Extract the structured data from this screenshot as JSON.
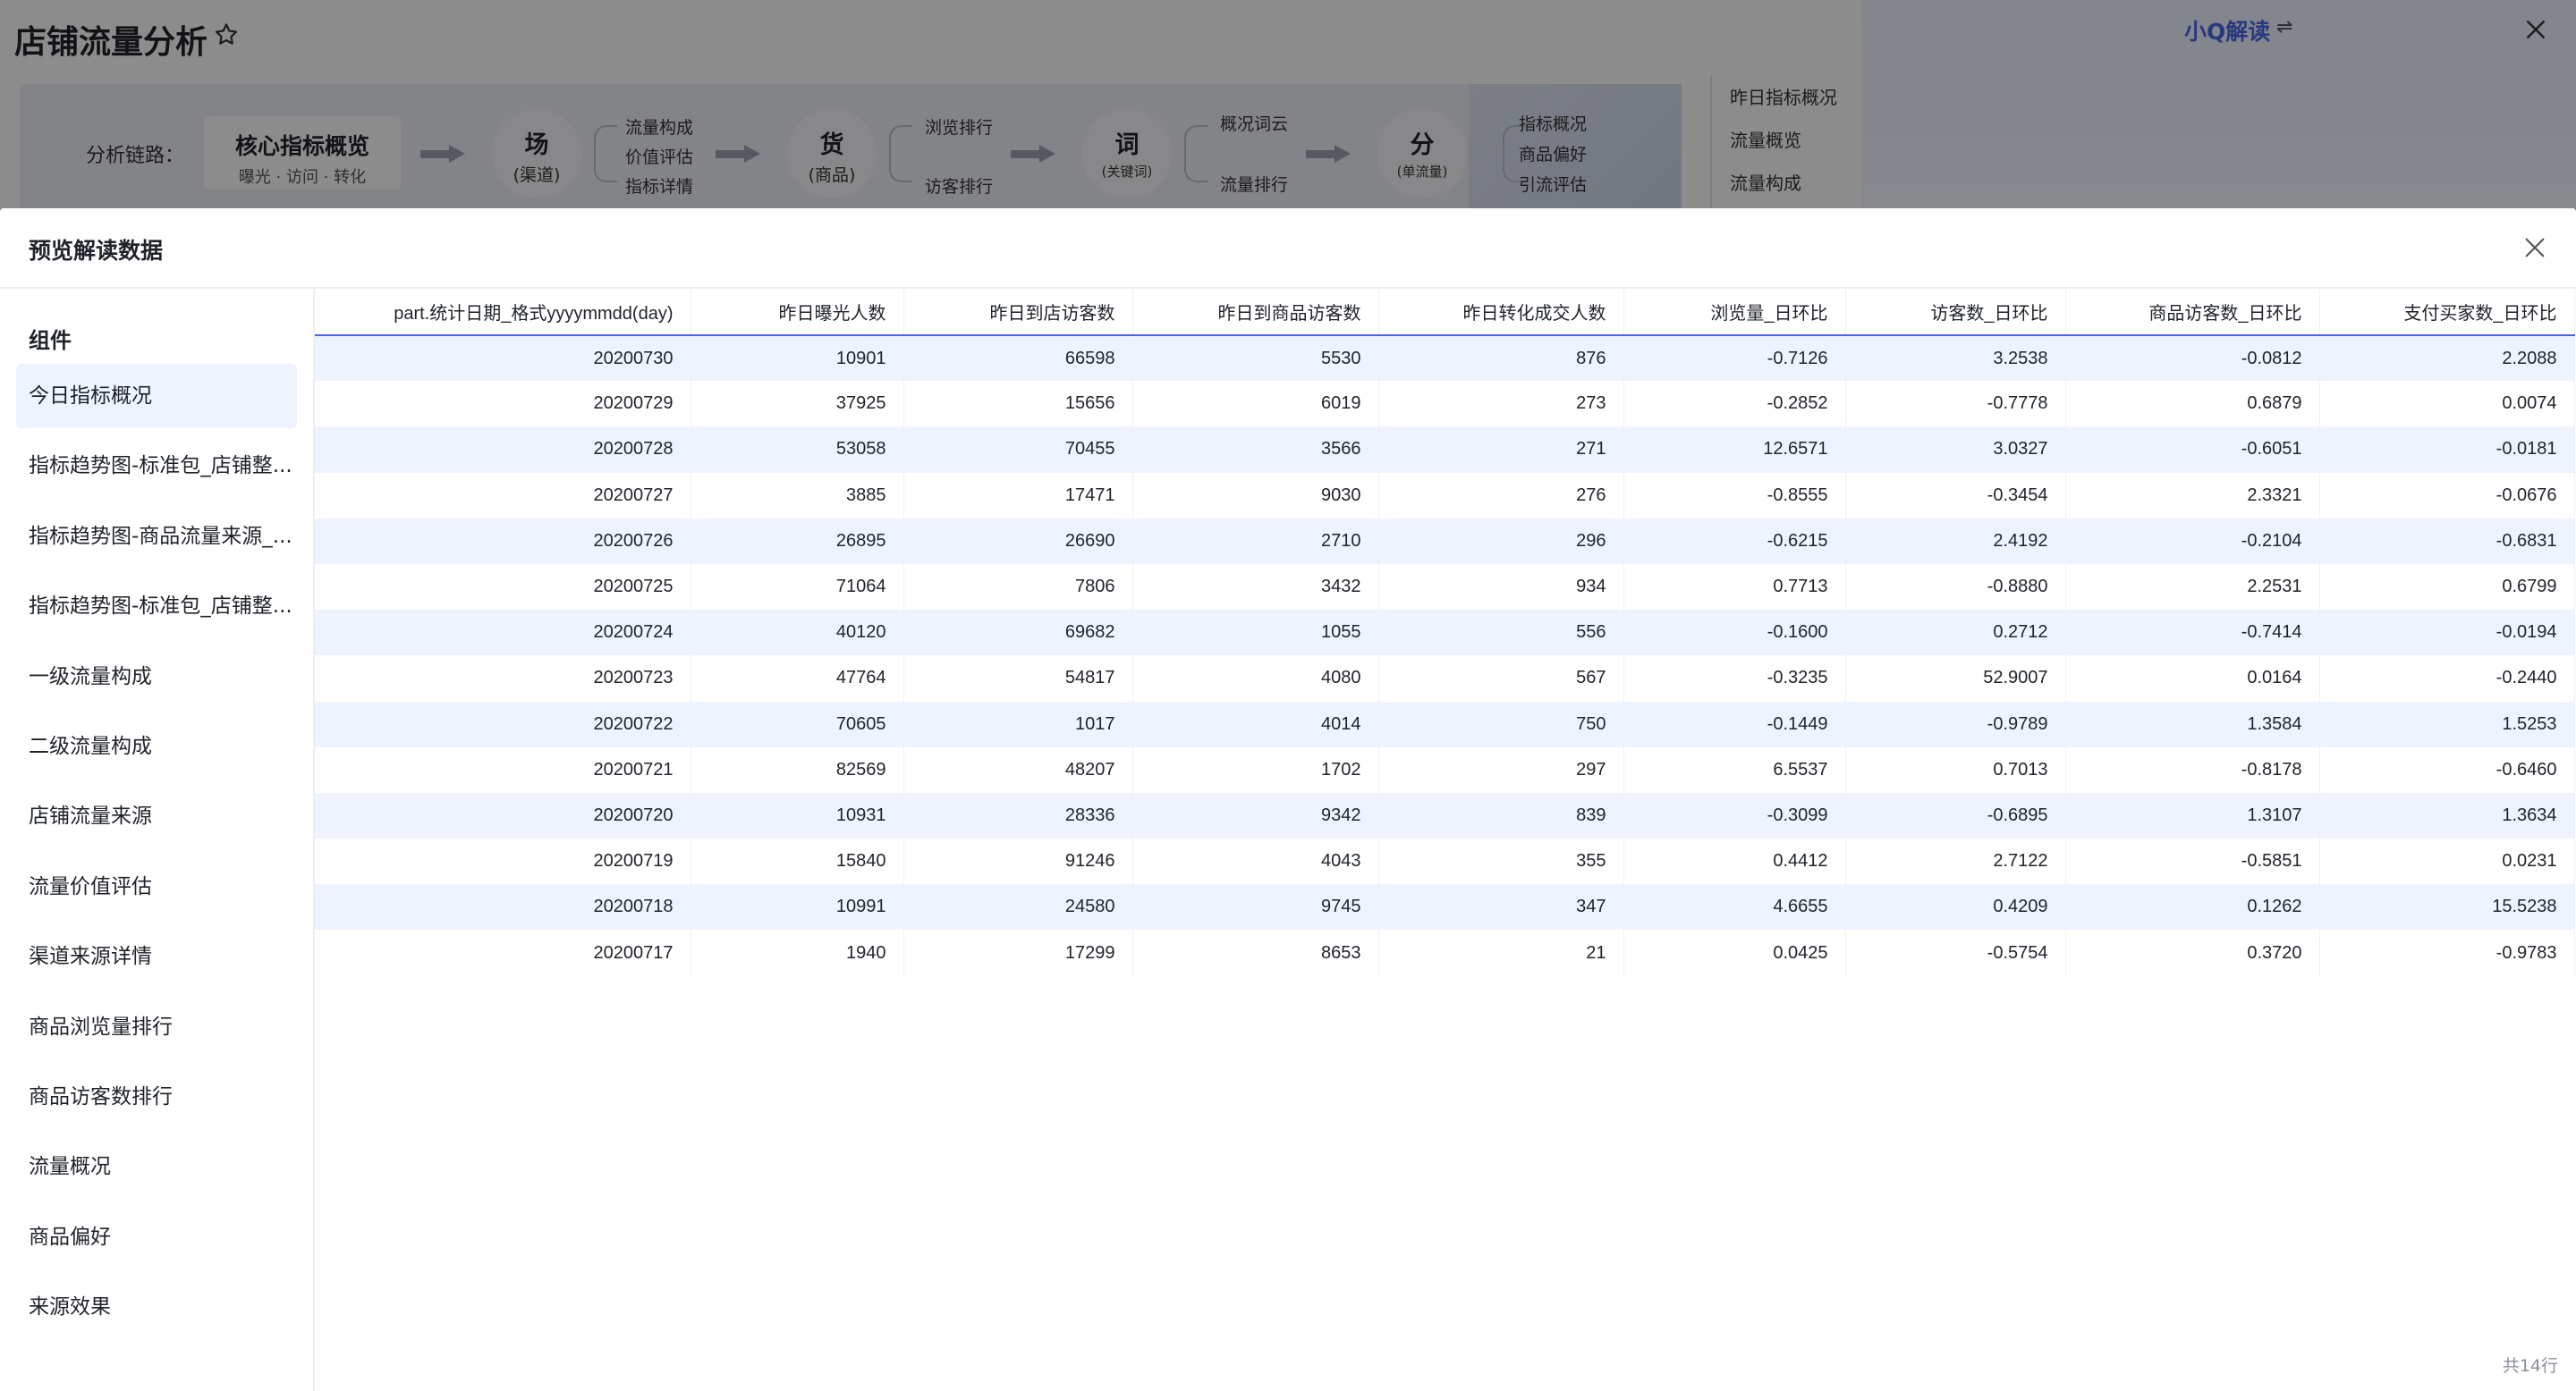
{
  "background": {
    "page_title": "店铺流量分析",
    "chain_label": "分析链路：",
    "core": {
      "title": "核心指标概览",
      "subtitle": "曝光 · 访问 · 转化"
    },
    "nodes": [
      {
        "main": "场",
        "sub": "(渠道)",
        "leaves": [
          "流量构成",
          "价值评估",
          "指标详情"
        ]
      },
      {
        "main": "货",
        "sub": "(商品)",
        "leaves": [
          "浏览排行",
          "访客排行"
        ]
      },
      {
        "main": "词",
        "sub": "(关键词)",
        "leaves": [
          "概况词云",
          "流量排行"
        ]
      },
      {
        "main": "分",
        "sub": "(单流量)",
        "leaves": [
          "指标概况",
          "商品偏好",
          "引流评估"
        ]
      }
    ],
    "side_links": [
      "昨日指标概况",
      "流量概览",
      "流量构成"
    ],
    "assistant_title": "小Q解读",
    "assistant_swap": "⇌",
    "colors": {
      "accent": "#4a66e8",
      "panel": "#eef1f7"
    }
  },
  "modal": {
    "title": "预览解读数据",
    "sidebar_heading": "组件",
    "components": [
      "今日指标概况",
      "指标趋势图-标准包_店铺整...",
      "指标趋势图-商品流量来源_...",
      "指标趋势图-标准包_店铺整...",
      "一级流量构成",
      "二级流量构成",
      "店铺流量来源",
      "流量价值评估",
      "渠道来源详情",
      "商品浏览量排行",
      "商品访客数排行",
      "流量概况",
      "商品偏好",
      "来源效果"
    ],
    "active_component": 0,
    "table": {
      "columns": [
        "part.统计日期_格式yyyymmdd(day)",
        "昨日曝光人数",
        "昨日到店访客数",
        "昨日到商品访客数",
        "昨日转化成交人数",
        "浏览量_日环比",
        "访客数_日环比",
        "商品访客数_日环比",
        "支付买家数_日环比"
      ],
      "rows": [
        [
          "20200730",
          "10901",
          "66598",
          "5530",
          "876",
          "-0.7126",
          "3.2538",
          "-0.0812",
          "2.2088"
        ],
        [
          "20200729",
          "37925",
          "15656",
          "6019",
          "273",
          "-0.2852",
          "-0.7778",
          "0.6879",
          "0.0074"
        ],
        [
          "20200728",
          "53058",
          "70455",
          "3566",
          "271",
          "12.6571",
          "3.0327",
          "-0.6051",
          "-0.0181"
        ],
        [
          "20200727",
          "3885",
          "17471",
          "9030",
          "276",
          "-0.8555",
          "-0.3454",
          "2.3321",
          "-0.0676"
        ],
        [
          "20200726",
          "26895",
          "26690",
          "2710",
          "296",
          "-0.6215",
          "2.4192",
          "-0.2104",
          "-0.6831"
        ],
        [
          "20200725",
          "71064",
          "7806",
          "3432",
          "934",
          "0.7713",
          "-0.8880",
          "2.2531",
          "0.6799"
        ],
        [
          "20200724",
          "40120",
          "69682",
          "1055",
          "556",
          "-0.1600",
          "0.2712",
          "-0.7414",
          "-0.0194"
        ],
        [
          "20200723",
          "47764",
          "54817",
          "4080",
          "567",
          "-0.3235",
          "52.9007",
          "0.0164",
          "-0.2440"
        ],
        [
          "20200722",
          "70605",
          "1017",
          "4014",
          "750",
          "-0.1449",
          "-0.9789",
          "1.3584",
          "1.5253"
        ],
        [
          "20200721",
          "82569",
          "48207",
          "1702",
          "297",
          "6.5537",
          "0.7013",
          "-0.8178",
          "-0.6460"
        ],
        [
          "20200720",
          "10931",
          "28336",
          "9342",
          "839",
          "-0.3099",
          "-0.6895",
          "1.3107",
          "1.3634"
        ],
        [
          "20200719",
          "15840",
          "91246",
          "4043",
          "355",
          "0.4412",
          "2.7122",
          "-0.5851",
          "0.0231"
        ],
        [
          "20200718",
          "10991",
          "24580",
          "9745",
          "347",
          "4.6655",
          "0.4209",
          "0.1262",
          "15.5238"
        ],
        [
          "20200717",
          "1940",
          "17299",
          "8653",
          "21",
          "0.0425",
          "-0.5754",
          "0.3720",
          "-0.9783"
        ]
      ],
      "footer": "共14行"
    }
  }
}
